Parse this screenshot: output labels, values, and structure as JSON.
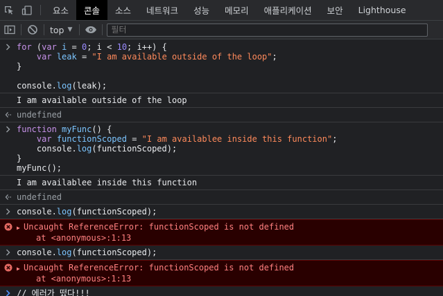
{
  "tabs": [
    {
      "label": "요소",
      "active": false
    },
    {
      "label": "콘솔",
      "active": true
    },
    {
      "label": "소스",
      "active": false
    },
    {
      "label": "네트워크",
      "active": false
    },
    {
      "label": "성능",
      "active": false
    },
    {
      "label": "메모리",
      "active": false
    },
    {
      "label": "애플리케이션",
      "active": false
    },
    {
      "label": "보안",
      "active": false
    },
    {
      "label": "Lighthouse",
      "active": false
    }
  ],
  "toolbar": {
    "context": "top",
    "filter_placeholder": "필터"
  },
  "console": {
    "e1": {
      "l1": [
        "for",
        " (",
        "var",
        " ",
        "i",
        " = ",
        "0",
        "; ",
        "i",
        " < ",
        "10",
        "; i++) {"
      ],
      "l2": [
        "    ",
        "var",
        " ",
        "leak",
        " = ",
        "\"I am available outside of the loop\"",
        ";"
      ],
      "l3": "}",
      "l4": "",
      "l5": [
        "console.",
        "log",
        "(leak);"
      ]
    },
    "o1": "I am available outside of the loop",
    "r1": "undefined",
    "e2": {
      "l1": [
        "function",
        " ",
        "myFunc",
        "() {"
      ],
      "l2": [
        "    ",
        "var",
        " ",
        "functionScoped",
        " = ",
        "\"I am availablee inside this function\"",
        ";"
      ],
      "l3": [
        "    console.",
        "log",
        "(functionScoped);"
      ],
      "l4": "}",
      "l5": "myFunc();"
    },
    "o2": "I am availablee inside this function",
    "r2": "undefined",
    "e3": [
      "console.",
      "log",
      "(functionScoped);"
    ],
    "err1": {
      "head": "Uncaught ReferenceError: functionScoped is not defined",
      "stack": "at <anonymous>:1:13"
    },
    "e4": [
      "console.",
      "log",
      "(functionScoped);"
    ],
    "err2": {
      "head": "Uncaught ReferenceError: functionScoped is not defined",
      "stack": "at <anonymous>:1:13"
    },
    "prompt": "// 에러가 떴다!!!"
  },
  "colors": {
    "keyword": "#c792ea",
    "number": "#9b8cff",
    "string": "#ff8a5b",
    "function": "#7cc5ff",
    "error_text": "#ff8080",
    "error_bg": "#290000"
  }
}
